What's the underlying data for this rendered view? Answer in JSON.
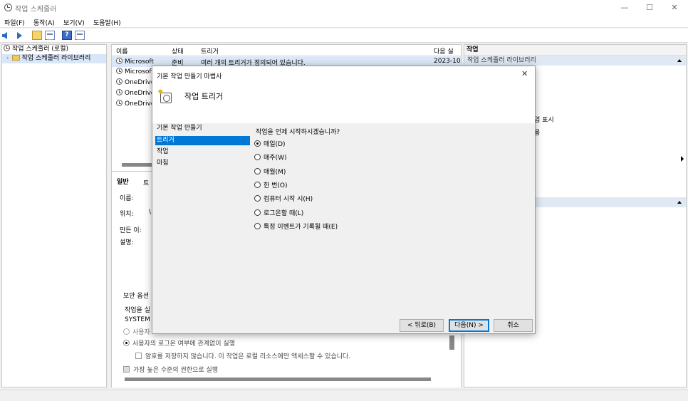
{
  "window": {
    "title": "작업 스케줄러",
    "controls": {
      "minimize": "—",
      "maximize": "☐",
      "close": "✕"
    }
  },
  "menu": [
    "파일(F)",
    "동작(A)",
    "보기(V)",
    "도움말(H)"
  ],
  "toolbar": {
    "help_glyph": "?"
  },
  "tree": {
    "root": "작업 스케줄러 (로컬)",
    "child": "작업 스케줄러 라이브러리",
    "expander": "›"
  },
  "task_list": {
    "columns": [
      "이름",
      "상태",
      "트리거",
      "다음 실"
    ],
    "rows": [
      {
        "name": "Microsoft",
        "status": "준비",
        "trigger": "여러 개의 트리거가 정의되어 있습니다.",
        "next": "2023-10"
      },
      {
        "name": "Microsoft",
        "status": "",
        "trigger": "",
        "next": ""
      },
      {
        "name": "OneDrive",
        "status": "",
        "trigger": "",
        "next": ""
      },
      {
        "name": "OneDrive",
        "status": "",
        "trigger": "",
        "next": ""
      },
      {
        "name": "OneDrive",
        "status": "",
        "trigger": "",
        "next": ""
      }
    ]
  },
  "details": {
    "tabs": [
      "일반",
      "트"
    ],
    "labels": {
      "name": "이름:",
      "location": "위치:",
      "author": "만든 이:",
      "description": "설명:"
    },
    "location_value": "\\",
    "security_title": "보안 옵션",
    "run_as_prefix": "작업을 실",
    "account": "SYSTEM",
    "opt_logged_on": "사용자",
    "opt_regardless": "사용자의 로그온 여부에 관계없이 실행",
    "no_store_password": "암호를 저장하지 않습니다. 이 작업은 로컬 리소스에만 액세스할 수 있습니다.",
    "highest_priv": "가장 높은 수준의 권한으로 실행"
  },
  "actions_pane": {
    "header": "작업",
    "section1": "작업 스케줄러 라이브러리",
    "fragment1": "업 표시",
    "fragment2": "용"
  },
  "wizard": {
    "title": "기본 작업 만들기 마법사",
    "close": "✕",
    "heading": "작업 트리거",
    "nav": [
      "기본 작업 만들기",
      "트리거",
      "작업",
      "마침"
    ],
    "nav_selected": 1,
    "question": "작업을 언제 시작하시겠습니까?",
    "options": [
      "매일(D)",
      "매주(W)",
      "매월(M)",
      "한 번(O)",
      "컴퓨터 시작 시(H)",
      "로그온할 때(L)",
      "특정 이벤트가 기록될 때(E)"
    ],
    "selected_option": 0,
    "buttons": {
      "back": "< 뒤로(B)",
      "next": "다음(N) >",
      "cancel": "취소"
    }
  }
}
